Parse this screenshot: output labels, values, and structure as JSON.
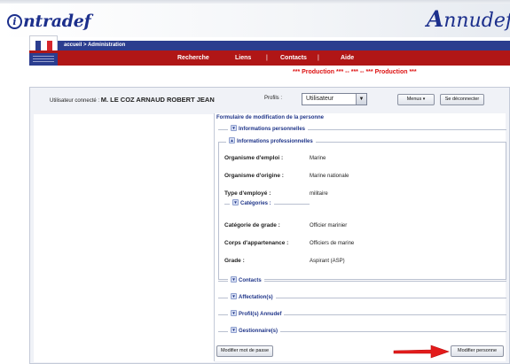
{
  "header": {
    "logo_left": "ntradef",
    "logo_left_initial": "i",
    "logo_right_initial": "A",
    "logo_right": "nnudef"
  },
  "nav": {
    "breadcrumb": "accueil > Administration",
    "items": [
      "Recherche",
      "Liens",
      "Contacts",
      "Aide"
    ],
    "separator": "|"
  },
  "production_banner": "*** Production *** -- *** -- *** Production ***",
  "userbar": {
    "connected_label": "Utilisateur connecté :",
    "user_name": "M. LE COZ ARNAUD ROBERT JEAN",
    "profil_label": "Profils :",
    "profil_value": "Utilisateur",
    "menus_label": "Menus",
    "logout_label": "Se déconnecter"
  },
  "form": {
    "title": "Formulaire de modification de la personne",
    "sections": {
      "personal": "Informations personnelles",
      "professional": "Informations professionnelles",
      "categories": "Catégories :",
      "contacts": "Contacts",
      "affectations": "Affectation(s)",
      "profils": "Profil(s) Annudef",
      "gestionnaires": "Gestionnaire(s)"
    },
    "fields": [
      {
        "label": "Organisme d'emploi :",
        "value": "Marine"
      },
      {
        "label": "Organisme d'origine :",
        "value": "Marine nationale"
      },
      {
        "label": "Type d'employé :",
        "value": "militaire"
      },
      {
        "label": "Catégorie de grade :",
        "value": "Officier marinier"
      },
      {
        "label": "Corps d'appartenance :",
        "value": "Officiers de marine"
      },
      {
        "label": "Grade :",
        "value": "Aspirant (ASP)"
      }
    ],
    "change_password_button": "Modifier mot de passe",
    "modify_person_button": "Modifier personne"
  },
  "colors": {
    "brand_blue": "#2b3d8f",
    "brand_red": "#b01616",
    "accent_link": "#1f3589",
    "arrow_red": "#e31b1b"
  }
}
